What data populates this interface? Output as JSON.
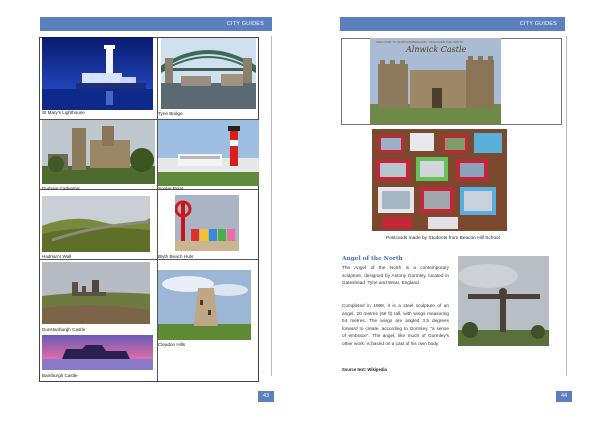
{
  "left_page": {
    "header": "CITY GUIDES",
    "page_number": "43",
    "captions": {
      "st_marys": "St Mary's Lighthouse",
      "tyne_bridge": "Tyne Bridge",
      "durham": "Durham Cathedral",
      "souter": "Souter Point",
      "hadrians": "Hadrian's Wall",
      "blyth": "Blyth Beach Huts",
      "dunstanburgh": "Dunstanburgh Castle",
      "cleadon": "Cleadon Hills",
      "bamburgh": "Bamburgh Castle"
    }
  },
  "right_page": {
    "header": "CITY GUIDES",
    "page_number": "44",
    "castle_banner_line": "WELCOME TO NORTHUMBERLAND · DISCOVER THE NORTH",
    "castle_banner_title": "Alnwick Castle",
    "postcards_caption": "Postcards made by Students from Beacon Hill School",
    "article_title": "Angel of the North",
    "paragraph1": "The Angel of the North is a contemporary sculpture, designed by Antony Gormley, located in Gateshead, Tyne and Wear, England.",
    "paragraph2": "Completed in 1998, it is a steel sculpture of an angel, 20 metres (66 ft) tall, with wings measuring 54 metres. The wings are angled 3.5 degrees forward to create, according to Gormley, \"a sense of embrace\". The angel, like much of Gormley's other work, is based on a cast of his own body.",
    "source": "Source text: Wikipedia"
  },
  "colors": {
    "accent": "#5b7fbf",
    "title_blue": "#4a6db3"
  }
}
